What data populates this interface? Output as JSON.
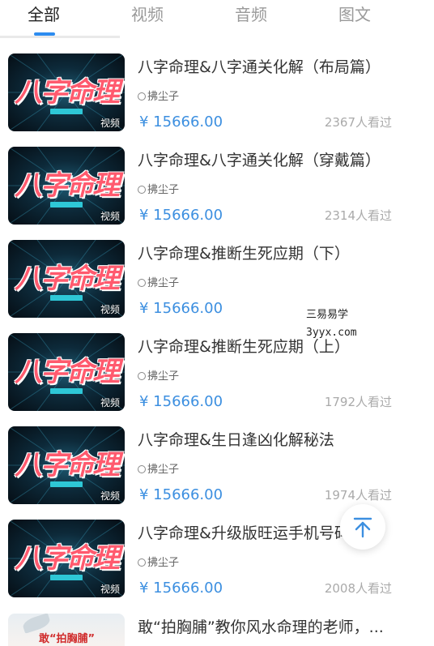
{
  "tabs": [
    {
      "label": "全部",
      "active": true
    },
    {
      "label": "视频",
      "active": false
    },
    {
      "label": "音频",
      "active": false
    },
    {
      "label": "图文",
      "active": false
    }
  ],
  "colors": {
    "accent": "#2d8cf0",
    "price": "#3c8fe0",
    "thumb_title": "#ff5a6e"
  },
  "items": [
    {
      "thumb_text": "八字命理",
      "badge": "视频",
      "title": "八字命理&八字通关化解（布局篇）",
      "author": "拂尘子",
      "price": "¥ 15666.00",
      "views": "2367人看过"
    },
    {
      "thumb_text": "八字命理",
      "badge": "视频",
      "title": "八字命理&八字通关化解（穿戴篇）",
      "author": "拂尘子",
      "price": "¥ 15666.00",
      "views": "2314人看过"
    },
    {
      "thumb_text": "八字命理",
      "badge": "视频",
      "title": "八字命理&推断生死应期（下）",
      "author": "拂尘子",
      "price": "¥ 15666.00",
      "views": ""
    },
    {
      "thumb_text": "八字命理",
      "badge": "视频",
      "title": "八字命理&推断生死应期（上）",
      "author": "拂尘子",
      "price": "¥ 15666.00",
      "views": "1792人看过"
    },
    {
      "thumb_text": "八字命理",
      "badge": "视频",
      "title": "八字命理&生日逢凶化解秘法",
      "author": "拂尘子",
      "price": "¥ 15666.00",
      "views": "1974人看过"
    },
    {
      "thumb_text": "八字命理",
      "badge": "视频",
      "title": "八字命理&升级版旺运手机号码",
      "author": "拂尘子",
      "price": "¥ 15666.00",
      "views": "2008人看过"
    }
  ],
  "last_item": {
    "title": "敢“拍胸脯”教你风水命理的老师，...",
    "thumb_text": "敢“拍胸脯”"
  },
  "watermark": {
    "line1": "三易易学",
    "line2": "3yyx.com"
  },
  "back_to_top_icon": "arrow-up-to-line-icon"
}
